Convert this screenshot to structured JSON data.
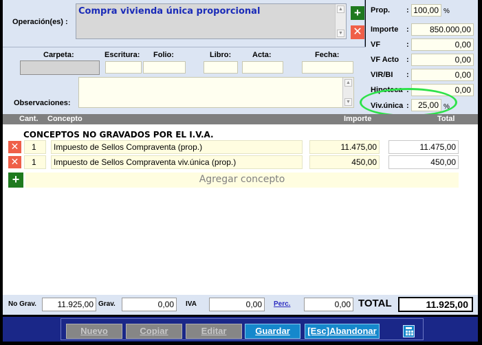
{
  "operation": {
    "label": "Operación(es) :",
    "value": "Compra vivienda única proporcional"
  },
  "right_panel": {
    "prop": {
      "label": "Prop.",
      "value": "100,00",
      "unit": "%"
    },
    "importe": {
      "label": "Importe",
      "value": "850.000,00"
    },
    "vf": {
      "label": "VF",
      "value": "0,00"
    },
    "vf_acto": {
      "label": "VF Acto",
      "value": "0,00"
    },
    "vir_bi": {
      "label": "VIR/BI",
      "value": "0,00"
    },
    "hipoteca": {
      "label": "Hipoteca",
      "value": "0,00"
    },
    "viv_unica": {
      "label": "Viv.única",
      "value": "25,00",
      "unit": "%"
    }
  },
  "record": {
    "carpeta": "Carpeta:",
    "escritura": "Escritura:",
    "folio": "Folio:",
    "libro": "Libro:",
    "acta": "Acta:",
    "fecha": "Fecha:",
    "observaciones": "Observaciones:"
  },
  "table": {
    "headers": {
      "cant": "Cant.",
      "concepto": "Concepto",
      "importe": "Importe",
      "total": "Total"
    },
    "section_title": "CONCEPTOS NO GRAVADOS POR EL I.V.A.",
    "rows": [
      {
        "cant": "1",
        "concepto": "Impuesto de Sellos Compraventa (prop.)",
        "importe": "11.475,00",
        "total": "11.475,00"
      },
      {
        "cant": "1",
        "concepto": "Impuesto de Sellos Compraventa viv.única (prop.)",
        "importe": "450,00",
        "total": "450,00"
      }
    ],
    "add_label": "Agregar concepto"
  },
  "totals": {
    "no_grav": {
      "label": "No Grav.",
      "value": "11.925,00"
    },
    "grav": {
      "label": "Grav.",
      "value": "0,00"
    },
    "iva": {
      "label": "IVA",
      "value": "0,00"
    },
    "perc": {
      "label": "Perc.",
      "value": "0,00"
    },
    "total": {
      "label": "TOTAL",
      "value": "11.925,00"
    }
  },
  "actions": {
    "nuevo": "Nuevo",
    "copiar": "Copiar",
    "editar": "Editar",
    "guardar": "Guardar",
    "abandonar": "[Esc]Abandonar"
  },
  "icons": {
    "add": "plus-icon",
    "remove": "close-icon",
    "calculator": "calculator-icon",
    "highlight": "green-oval-annotation"
  },
  "colors": {
    "panel_bg": "#dce5f3",
    "field_bg": "#fffff0",
    "add_green": "#1f7a1f",
    "remove_red": "#ef5f48",
    "action_bar": "#1a2788",
    "button_blue": "#1588cc",
    "annotation_green": "#2ee24a",
    "op_text_blue": "#1a2bb8"
  }
}
